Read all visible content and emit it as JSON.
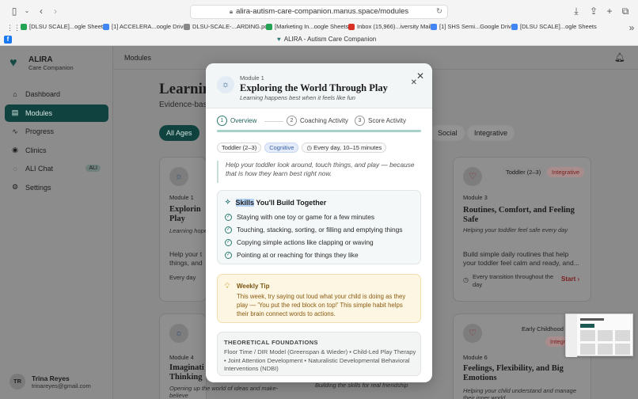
{
  "browser": {
    "url": "alira-autism-care-companion.manus.space/modules",
    "tab_title": "ALIRA - Autism Care Companion",
    "bookmarks": [
      {
        "label": "[DLSU SCALE]...ogle Sheets",
        "icon": "sheets-icon",
        "color": "#23a455"
      },
      {
        "label": "[1] ACCELERA...oogle Drive",
        "icon": "google-icon",
        "color": "#4285f4"
      },
      {
        "label": "DLSU-SCALE-...ARDING.pdf",
        "icon": "pdf-icon",
        "color": "#888888"
      },
      {
        "label": "[Marketing In...oogle Sheets",
        "icon": "sheets-icon",
        "color": "#23a455"
      },
      {
        "label": "Inbox (15,966)...iversity Mail",
        "icon": "gmail-icon",
        "color": "#d93025"
      },
      {
        "label": "[1] SHS Semi...Google Drive",
        "icon": "google-icon",
        "color": "#4285f4"
      },
      {
        "label": "[DLSU SCALE]...ogle Sheets",
        "icon": "google-icon",
        "color": "#4285f4"
      }
    ]
  },
  "app": {
    "brand_name": "ALIRA",
    "brand_sub": "Care Companion",
    "topbar_title": "Modules",
    "nav": [
      {
        "label": "Dashboard",
        "icon": "home-icon",
        "glyph": "⌂",
        "active": false,
        "badge": ""
      },
      {
        "label": "Modules",
        "icon": "book-icon",
        "glyph": "▤",
        "active": true,
        "badge": ""
      },
      {
        "label": "Progress",
        "icon": "activity-icon",
        "glyph": "∿",
        "active": false,
        "badge": ""
      },
      {
        "label": "Clinics",
        "icon": "map-pin-icon",
        "glyph": "◉",
        "active": false,
        "badge": ""
      },
      {
        "label": "ALI Chat",
        "icon": "chat-icon",
        "glyph": "◌",
        "active": false,
        "badge": "ALI"
      },
      {
        "label": "Settings",
        "icon": "gear-icon",
        "glyph": "⚙",
        "active": false,
        "badge": ""
      }
    ],
    "user": {
      "initials": "TR",
      "name": "Trina Reyes",
      "email": "trinareyes@gmail.com"
    },
    "page_heading": "Learnin",
    "page_sub": "Evidence-bas",
    "filter_chips": [
      "All Ages",
      "Social",
      "Integrative"
    ],
    "cards": [
      {
        "module": "Module 1",
        "title": "Explorin Play",
        "subtitle": "Learning hope",
        "desc": "Help your t things, and",
        "meta": "Every day"
      },
      {
        "module": "Module 3",
        "title": "Routines, Comfort, and Feeling Safe",
        "subtitle": "Helping your toddler feel safe every day",
        "desc": "Build simple daily routines that help your toddler feel calm and ready, and...",
        "meta": "Every transition throughout the day",
        "tag1": "Toddler (2–3)",
        "tag2": "Integrative",
        "start": "Start"
      },
      {
        "module": "Module 4",
        "title": "Imaginati Thinking",
        "subtitle": "Opening up the world of ideas and make-believe"
      },
      {
        "module": "Module 6",
        "title": "Feelings, Flexibility, and Big Emotions",
        "subtitle": "Helping your child understand and manage their inner world",
        "tag1": "Early Childhood (",
        "tag2": "Integr"
      },
      {
        "subtitle": "Building the skills for real friendship"
      }
    ]
  },
  "modal": {
    "module_label": "Module 1",
    "title": "Exploring the World Through Play",
    "tagline": "Learning happens best when it feels like fun",
    "steps": [
      {
        "num": "1",
        "label": "Overview",
        "active": true
      },
      {
        "num": "2",
        "label": "Coaching Activity",
        "active": false
      },
      {
        "num": "3",
        "label": "Score Activity",
        "active": false
      }
    ],
    "progress_fraction": 1.0,
    "chips": {
      "age": "Toddler (2–3)",
      "domain": "Cognitive",
      "frequency": "Every day, 10–15 minutes"
    },
    "intro": "Help your toddler look around, touch things, and play — because that is how they learn best right now.",
    "skills_heading_a": "Skills",
    "skills_heading_b": "You'll Build Together",
    "skills": [
      "Staying with one toy or game for a few minutes",
      "Touching, stacking, sorting, or filling and emptying things",
      "Copying simple actions like clapping or waving",
      "Pointing at or reaching for things they like"
    ],
    "tip_heading": "Weekly Tip",
    "tip_body": "This week, try saying out loud what your child is doing as they play — 'You put the red block on top!' This simple habit helps their brain connect words to actions.",
    "foundations_heading": "THEORETICAL FOUNDATIONS",
    "foundations_body": "Floor Time / DIR Model (Greenspan & Wieder) • Child-Led Play Therapy • Joint Attention Development • Naturalistic Developmental Behavioral Interventions (NDBI)"
  }
}
